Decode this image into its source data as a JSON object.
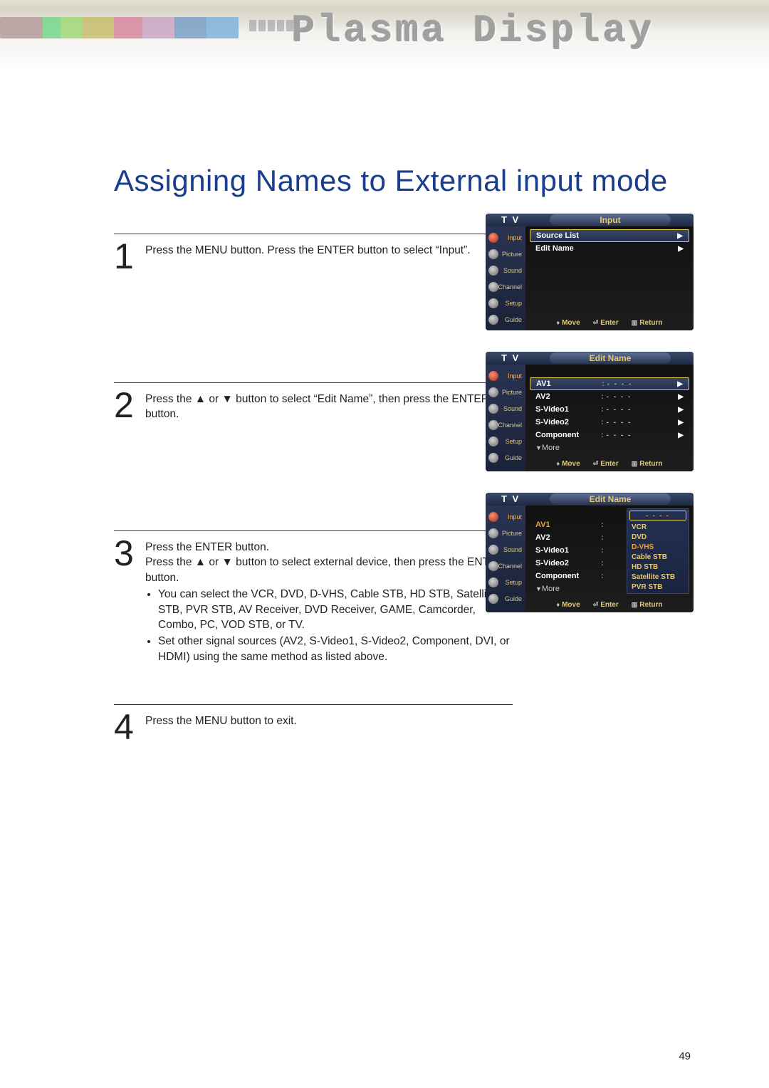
{
  "banner": {
    "title": "Plasma Display"
  },
  "page": {
    "title": "Assigning Names to External input mode",
    "page_number": "49"
  },
  "steps": [
    {
      "num": "1",
      "text": "Press the MENU button. Press the ENTER button to select “Input”."
    },
    {
      "num": "2",
      "text": "Press the ▲ or ▼ button to select “Edit Name”, then press the ENTER button."
    },
    {
      "num": "3",
      "text": "Press the ENTER button.\nPress the ▲ or ▼ button to select external device, then press the ENTER button.",
      "bullets": [
        "You can select the VCR, DVD, D-VHS, Cable STB, HD STB, Satellite STB, PVR STB, AV Receiver, DVD Receiver, GAME, Camcorder, Combo, PC, VOD STB, or TV.",
        "Set other signal sources (AV2, S-Video1, S-Video2, Component, DVI, or HDMI) using the same method as listed above."
      ]
    },
    {
      "num": "4",
      "text": "Press the MENU button to exit."
    }
  ],
  "osd_common": {
    "tv_label": "T V",
    "sidebar": [
      "Input",
      "Picture",
      "Sound",
      "Channel",
      "Setup",
      "Guide"
    ],
    "footer": {
      "move": "Move",
      "enter": "Enter",
      "return": "Return"
    }
  },
  "osd1": {
    "tab": "Input",
    "rows": [
      {
        "label": "Source List",
        "hl": true,
        "arrow": true
      },
      {
        "label": "Edit Name",
        "hl": false,
        "arrow": true
      }
    ]
  },
  "osd2": {
    "tab": "Edit Name",
    "rows": [
      {
        "label": "AV1",
        "val": "- - - -",
        "hl": true,
        "arrow": true
      },
      {
        "label": "AV2",
        "val": "- - - -",
        "arrow": true
      },
      {
        "label": "S-Video1",
        "val": "- - - -",
        "arrow": true
      },
      {
        "label": "S-Video2",
        "val": "- - - -",
        "arrow": true
      },
      {
        "label": "Component",
        "val": "- - - -",
        "arrow": true
      }
    ],
    "more": "More"
  },
  "osd3": {
    "tab": "Edit Name",
    "rows": [
      {
        "label": "AV1",
        "orange": true
      },
      {
        "label": "AV2"
      },
      {
        "label": "S-Video1"
      },
      {
        "label": "S-Video2"
      },
      {
        "label": "Component"
      }
    ],
    "more": "More",
    "dropdown": {
      "head": "- - - -",
      "items": [
        "VCR",
        "DVD",
        "D-VHS",
        "Cable STB",
        "HD STB",
        "Satellite STB",
        "PVR STB"
      ]
    }
  }
}
